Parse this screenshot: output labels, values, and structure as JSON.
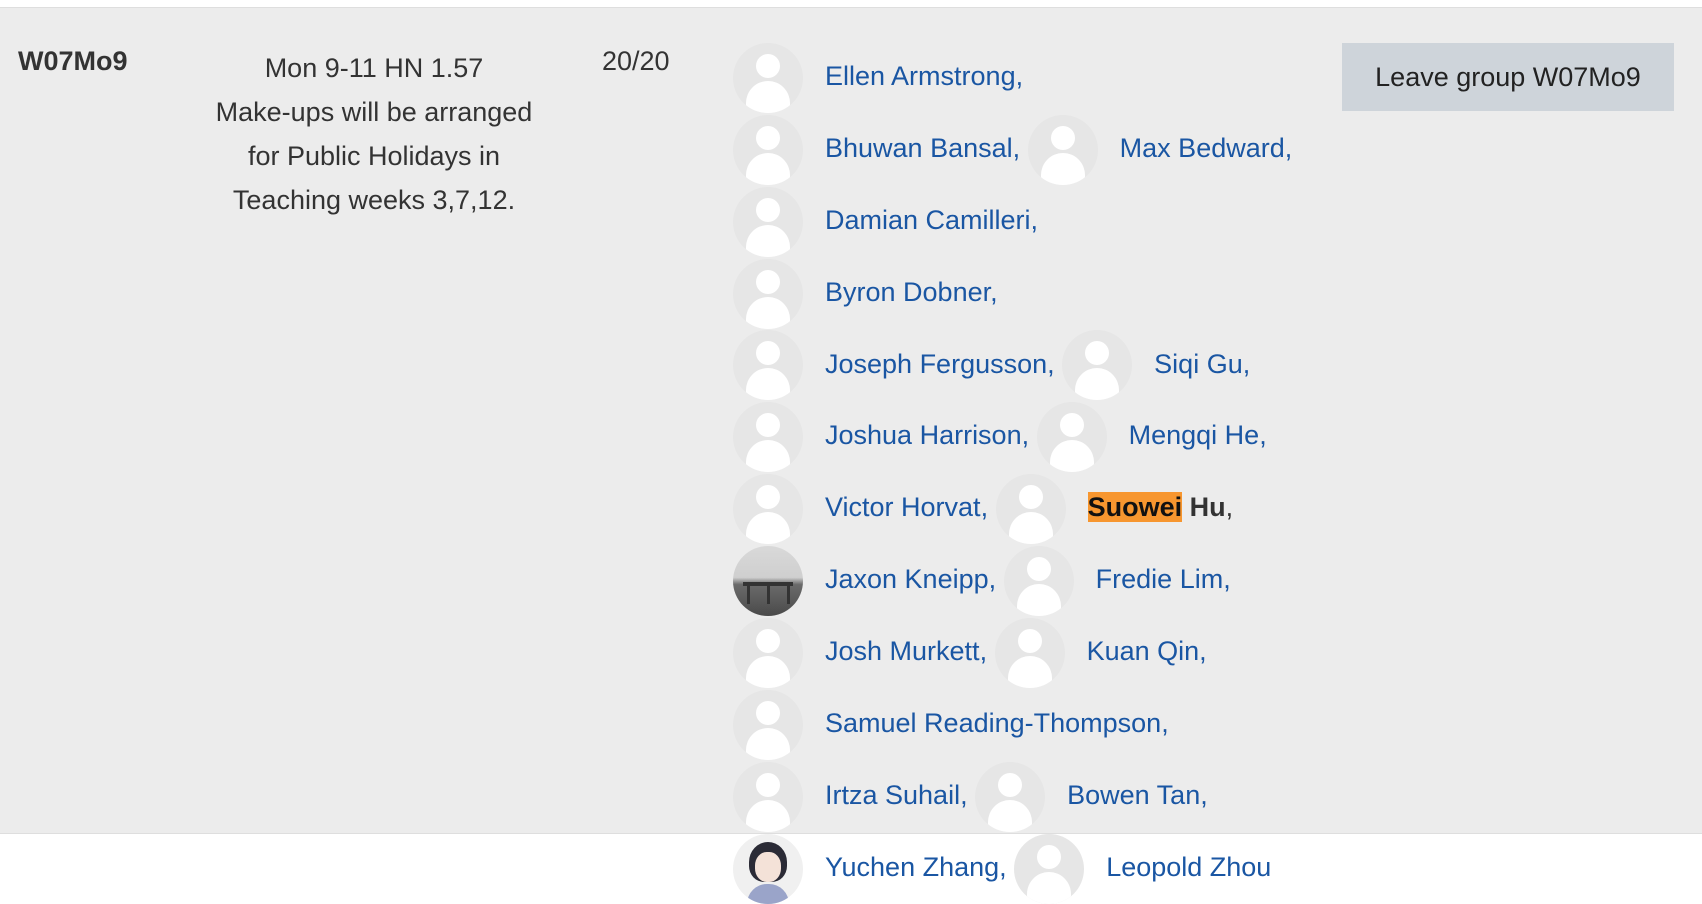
{
  "group": {
    "name": "W07Mo9",
    "description_lines": [
      "Mon 9-11 HN 1.57",
      "Make-ups will be arranged",
      "for Public Holidays in",
      "Teaching weeks 3,7,12."
    ],
    "count": "20/20",
    "leave_button_label": "Leave group W07Mo9"
  },
  "members": [
    {
      "name": "Ellen Armstrong",
      "avatar": "default-user-icon"
    },
    {
      "name": "Bhuwan Bansal",
      "avatar": "default-user-icon"
    },
    {
      "name": "Max Bedward",
      "avatar": "default-user-icon"
    },
    {
      "name": "Damian Camilleri",
      "avatar": "default-user-icon"
    },
    {
      "name": "Byron Dobner",
      "avatar": "default-user-icon"
    },
    {
      "name": "Joseph Fergusson",
      "avatar": "default-user-icon"
    },
    {
      "name": "Siqi Gu",
      "avatar": "default-user-icon"
    },
    {
      "name": "Joshua Harrison",
      "avatar": "default-user-icon"
    },
    {
      "name": "Mengqi He",
      "avatar": "default-user-icon"
    },
    {
      "name": "Victor Horvat",
      "avatar": "default-user-icon"
    },
    {
      "name_first": "Suowei",
      "name_last": "Hu",
      "avatar": "default-user-icon",
      "current_user": true
    },
    {
      "name": "Jaxon Kneipp",
      "avatar": "photo-outdoor"
    },
    {
      "name": "Fredie Lim",
      "avatar": "default-user-icon"
    },
    {
      "name": "Josh Murkett",
      "avatar": "default-user-icon"
    },
    {
      "name": "Kuan Qin",
      "avatar": "default-user-icon"
    },
    {
      "name": "Samuel Reading-Thompson",
      "avatar": "default-user-icon"
    },
    {
      "name": "Irtza Suhail",
      "avatar": "default-user-icon"
    },
    {
      "name": "Bowen Tan",
      "avatar": "default-user-icon"
    },
    {
      "name": "Yuchen Zhang",
      "avatar": "photo-girl"
    },
    {
      "name": "Leopold Zhou",
      "avatar": "default-user-icon"
    }
  ],
  "separator": ",",
  "colors": {
    "row_background": "#ececec",
    "link": "#1a56a3",
    "highlight": "#f7962f",
    "button_background": "#ced4da"
  }
}
